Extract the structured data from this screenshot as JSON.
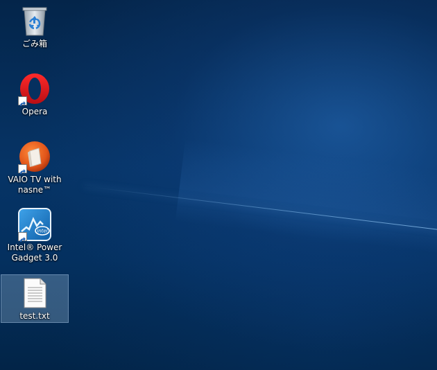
{
  "desktop": {
    "icons": [
      {
        "label": "ごみ箱",
        "icon": "recycle-bin-icon"
      },
      {
        "label": "Opera",
        "icon": "opera-icon"
      },
      {
        "label": "VAIO TV with nasne™",
        "icon": "vaio-tv-icon"
      },
      {
        "label": "Intel® Power Gadget 3.0",
        "icon": "intel-power-gadget-icon"
      },
      {
        "label": "test.txt",
        "icon": "text-file-icon",
        "selected": true
      }
    ]
  },
  "colors": {
    "background": "#063466",
    "opera_red": "#e0161d",
    "vaio_orange": "#e0541a",
    "intel_blue": "#1c7ac8",
    "selection": "#8fb2d2"
  }
}
